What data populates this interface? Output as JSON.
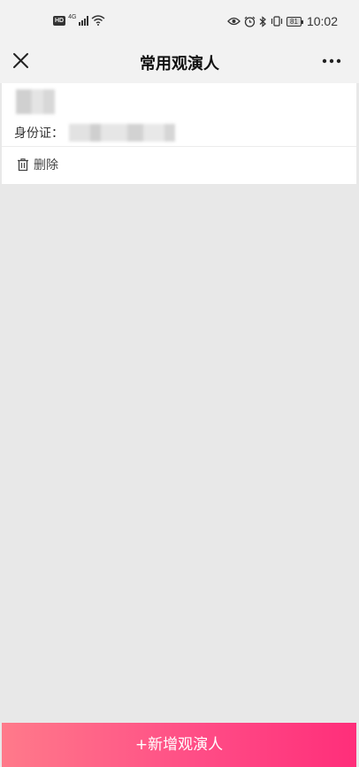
{
  "status_bar": {
    "hd_badge": "HD",
    "network": "4G",
    "battery": "81",
    "time": "10:02"
  },
  "nav": {
    "title": "常用观演人",
    "close_icon": "close-icon",
    "more_icon": "more-icon"
  },
  "viewer_card": {
    "id_label": "身份证：",
    "delete_label": "删除",
    "delete_icon": "trash-icon"
  },
  "footer": {
    "add_label": "+新增观演人"
  },
  "colors": {
    "accent_start": "#ff7a8a",
    "accent_end": "#ff2e7a",
    "background": "#e8e8e8"
  }
}
